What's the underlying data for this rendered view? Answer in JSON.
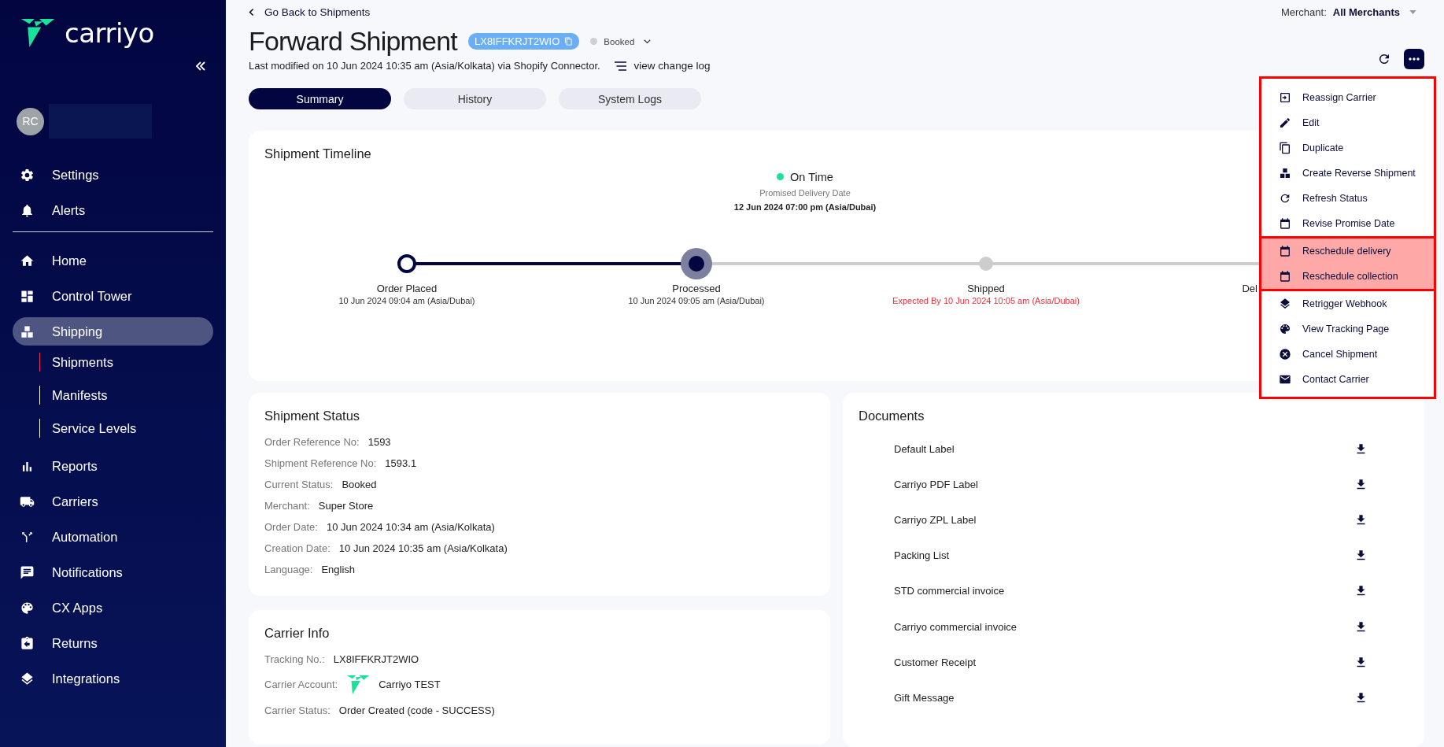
{
  "sidebar": {
    "logo": "carriyo",
    "avatar": "RC",
    "top_items": [
      {
        "label": "Settings"
      },
      {
        "label": "Alerts"
      }
    ],
    "nav_items": [
      {
        "label": "Home",
        "selected": false
      },
      {
        "label": "Control Tower",
        "selected": false
      },
      {
        "label": "Shipping",
        "selected": true,
        "children": [
          {
            "label": "Shipments",
            "selected": true
          },
          {
            "label": "Manifests",
            "selected": false
          },
          {
            "label": "Service Levels",
            "selected": false
          }
        ]
      },
      {
        "label": "Reports",
        "selected": false
      },
      {
        "label": "Carriers",
        "selected": false
      },
      {
        "label": "Automation",
        "selected": false
      },
      {
        "label": "Notifications",
        "selected": false
      },
      {
        "label": "CX Apps",
        "selected": false
      },
      {
        "label": "Returns",
        "selected": false
      },
      {
        "label": "Integrations",
        "selected": false
      }
    ]
  },
  "header": {
    "back_link": "Go Back to Shipments",
    "title": "Forward Shipment",
    "tracking_chip": "LX8IFFKRJT2WIO",
    "status": "Booked",
    "last_modified": "Last modified on 10 Jun 2024 10:35 am (Asia/Kolkata) via Shopify Connector.",
    "change_log": "view change log",
    "merchant_label": "Merchant:",
    "merchant_value": "All Merchants"
  },
  "tabs": [
    {
      "label": "Summary",
      "selected": true
    },
    {
      "label": "History",
      "selected": false
    },
    {
      "label": "System Logs",
      "selected": false
    }
  ],
  "timeline": {
    "title": "Shipment Timeline",
    "on_time": "On Time",
    "promised_label": "Promised Delivery Date",
    "promised_date": "12 Jun 2024 07:00 pm (Asia/Dubai)",
    "steps": [
      {
        "name": "Order Placed",
        "date": "10 Jun 2024 09:04 am (Asia/Dubai)",
        "completed": true,
        "active": false
      },
      {
        "name": "Processed",
        "date": "10 Jun 2024 09:05 am (Asia/Dubai)",
        "completed": true,
        "active": true
      },
      {
        "name": "Shipped",
        "date": "Expected By 10 Jun 2024 10:05 am (Asia/Dubai)",
        "completed": false,
        "active": false,
        "overdue": true
      },
      {
        "name": "Del"
      }
    ]
  },
  "shipment_status": {
    "title": "Shipment Status",
    "fields": [
      {
        "label": "Order Reference No:",
        "value": "1593"
      },
      {
        "label": "Shipment Reference No:",
        "value": "1593.1"
      },
      {
        "label": "Current Status:",
        "value": "Booked"
      },
      {
        "label": "Merchant:",
        "value": "Super Store"
      },
      {
        "label": "Order Date:",
        "value": "10 Jun 2024 10:34 am (Asia/Kolkata)"
      },
      {
        "label": "Creation Date:",
        "value": "10 Jun 2024 10:35 am (Asia/Kolkata)"
      },
      {
        "label": "Language:",
        "value": "English"
      }
    ]
  },
  "carrier_info": {
    "title": "Carrier Info",
    "fields": [
      {
        "label": "Tracking No.:",
        "value": "LX8IFFKRJT2WIO",
        "kind": "text"
      },
      {
        "label": "Carrier Account:",
        "value": "Carriyo TEST",
        "kind": "logo"
      },
      {
        "label": "Carrier Status:",
        "value": "Order Created (code - SUCCESS)",
        "kind": "text"
      }
    ]
  },
  "documents": {
    "title": "Documents",
    "items": [
      "Default Label",
      "Carriyo PDF Label",
      "Carriyo ZPL Label",
      "Packing List",
      "STD commercial invoice",
      "Carriyo commercial invoice",
      "Customer Receipt",
      "Gift Message"
    ]
  },
  "actions_menu": {
    "groups": [
      {
        "highlighted": false,
        "items": [
          "Reassign Carrier",
          "Edit",
          "Duplicate",
          "Create Reverse Shipment",
          "Refresh Status",
          "Revise Promise Date"
        ]
      },
      {
        "highlighted": true,
        "items": [
          "Reschedule delivery",
          "Reschedule collection"
        ]
      },
      {
        "highlighted": false,
        "items": [
          "Retrigger Webhook",
          "View Tracking Page",
          "Cancel Shipment",
          "Contact Carrier"
        ]
      }
    ]
  }
}
